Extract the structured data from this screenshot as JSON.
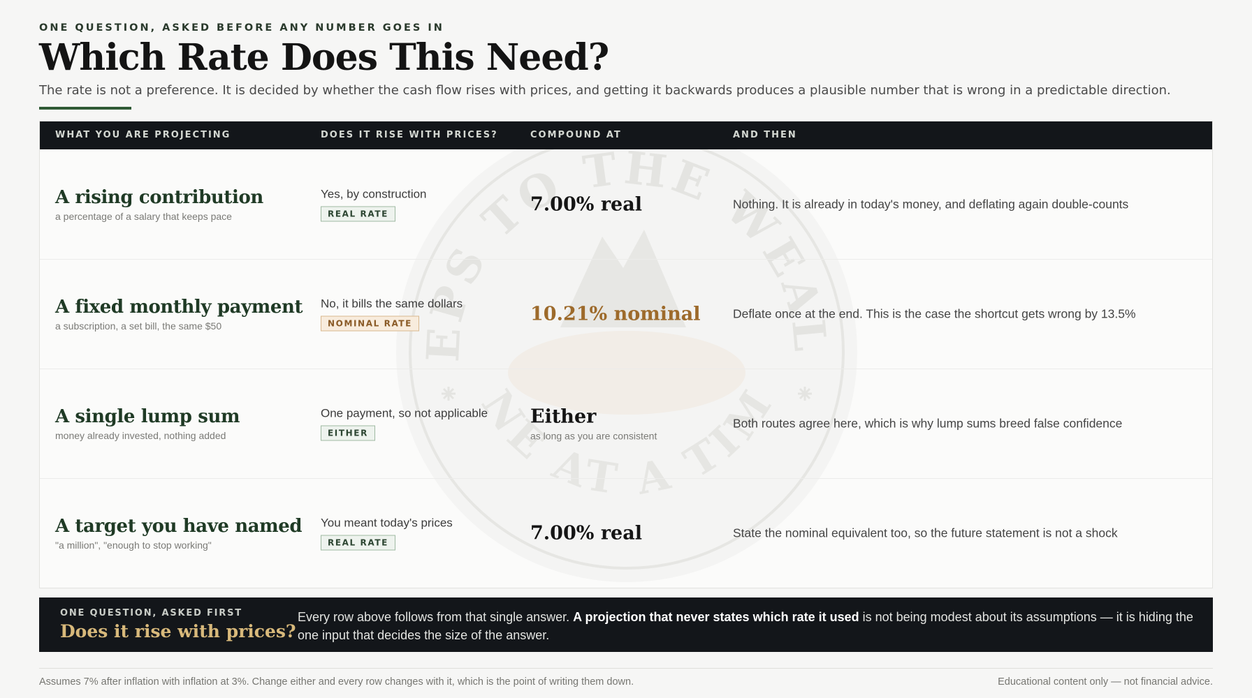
{
  "header": {
    "eyebrow": "ONE QUESTION, ASKED BEFORE ANY NUMBER GOES IN",
    "title": "Which Rate Does This Need?",
    "subtitle": "The rate is not a preference. It is decided by whether the cash flow rises with prices, and getting it backwards produces a plausible number that is wrong in a predictable direction."
  },
  "table": {
    "columns": [
      "WHAT YOU ARE PROJECTING",
      "DOES IT RISE WITH PRICES?",
      "COMPOUND AT",
      "AND THEN"
    ],
    "rows": [
      {
        "title": "A rising contribution",
        "subtitle": "a percentage of a salary that keeps pace",
        "rise": "Yes, by construction",
        "badge": "REAL RATE",
        "rate": "7.00% real",
        "rate_sub": "",
        "then": "Nothing. It is already in today's money, and deflating again double-counts"
      },
      {
        "title": "A fixed monthly payment",
        "subtitle": "a subscription, a set bill, the same $50",
        "rise": "No, it bills the same dollars",
        "badge": "NOMINAL RATE",
        "rate": "10.21% nominal",
        "rate_sub": "",
        "then": "Deflate once at the end. This is the case the shortcut gets wrong by 13.5%"
      },
      {
        "title": "A single lump sum",
        "subtitle": "money already invested, nothing added",
        "rise": "One payment, so not applicable",
        "badge": "EITHER",
        "rate": "Either",
        "rate_sub": "as long as you are consistent",
        "then": "Both routes agree here, which is why lump sums breed false confidence"
      },
      {
        "title": "A target you have named",
        "subtitle": "\"a million\", \"enough to stop working\"",
        "rise": "You meant today's prices",
        "badge": "REAL RATE",
        "rate": "7.00% real",
        "rate_sub": "",
        "then": "State the nominal equivalent too, so the future statement is not a shock"
      }
    ]
  },
  "watermark": {
    "top_text": "STEPS TO THE WEALTH",
    "bottom_text": "ONE AT A TIME"
  },
  "banner": {
    "kicker": "ONE QUESTION, ASKED FIRST",
    "question": "Does it rise with prices?",
    "body_lead": "Every row above follows from that single answer. ",
    "body_bold": "A projection that never states which rate it used",
    "body_rest": " is not being modest about its assumptions — it is hiding the one input that decides the size of the answer."
  },
  "footer": {
    "left": "Assumes 7% after inflation with inflation at 3%. Change either and every row changes with it, which is the point of writing them down.",
    "right": "Educational content only — not financial advice."
  },
  "colors": {
    "background": "#f6f6f5",
    "dark": "#13161a",
    "green": "#2f5a35",
    "nominal_accent": "#9d6a2b",
    "gold": "#d8b97b"
  }
}
